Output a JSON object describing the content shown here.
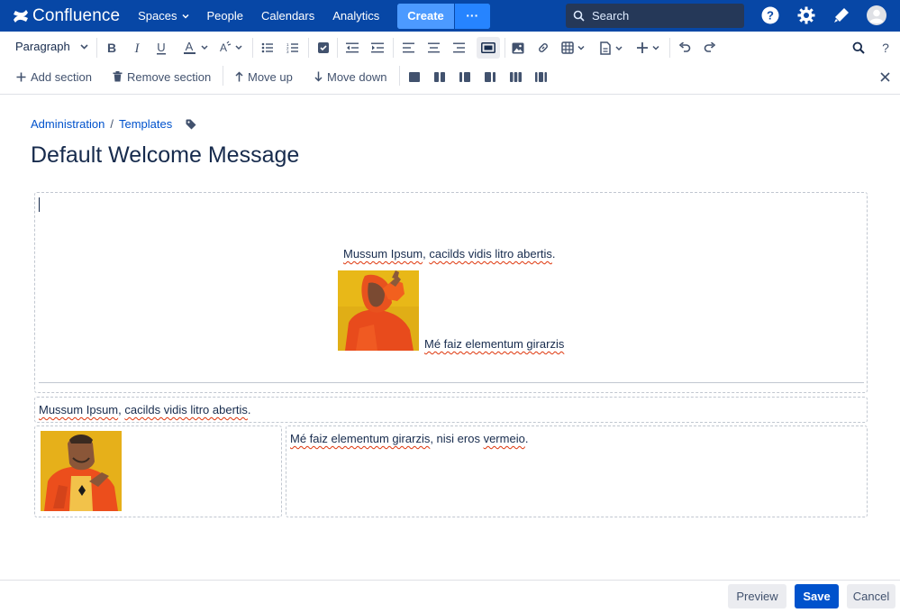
{
  "nav": {
    "logo": "Confluence",
    "items": [
      "Spaces",
      "People",
      "Calendars",
      "Analytics"
    ],
    "create": "Create",
    "more": "···",
    "search_placeholder": "Search"
  },
  "toolbar": {
    "paragraph": "Paragraph",
    "add_section": "Add section",
    "remove_section": "Remove section",
    "move_up": "Move up",
    "move_down": "Move down"
  },
  "breadcrumb": {
    "admin": "Administration",
    "sep": "/",
    "templates": "Templates"
  },
  "page": {
    "title": "Default Welcome Message"
  },
  "content": {
    "s1_line1_a": "Mussum Ipsum",
    "s1_line1_b": ", ",
    "s1_line1_c": "cacilds vidis litro abertis",
    "s1_line1_d": ".",
    "s1_caption_a": "Mé faiz elementum girarzis",
    "s2_text_a": "Mussum Ipsum",
    "s2_text_b": ", ",
    "s2_text_c": "cacilds vidis litro abertis",
    "s2_text_d": ".",
    "s3_text_a": "Mé faiz elementum girarzis",
    "s3_text_b": ", nisi eros ",
    "s3_text_c": "vermeio",
    "s3_text_d": "."
  },
  "footer": {
    "preview": "Preview",
    "save": "Save",
    "cancel": "Cancel"
  },
  "colors": {
    "nav_bg": "#0747A6",
    "primary": "#0052CC",
    "create": "#4C9AFF"
  }
}
